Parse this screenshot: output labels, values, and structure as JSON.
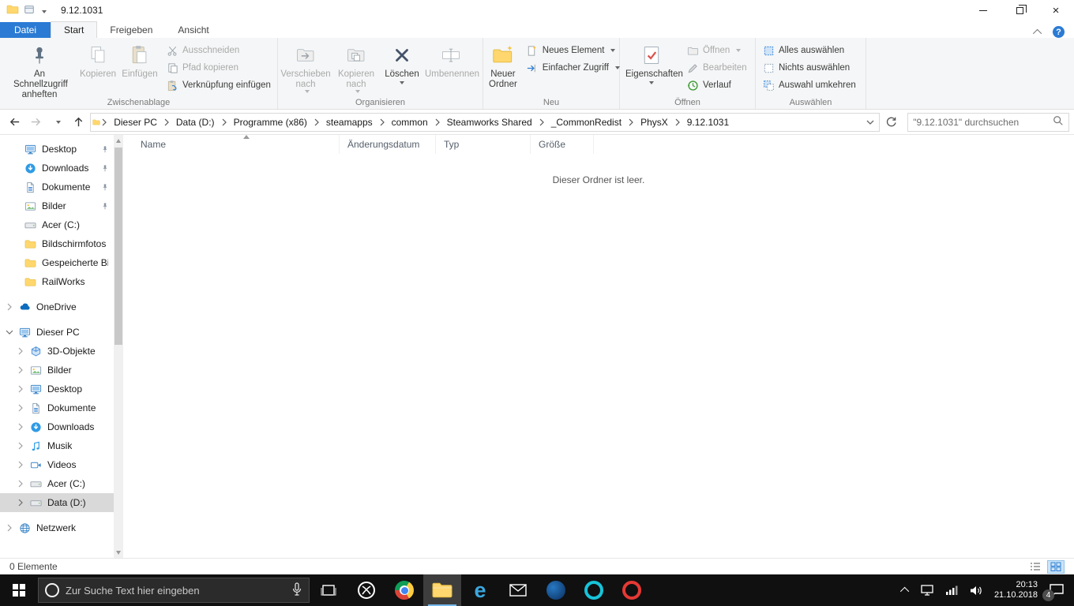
{
  "titlebar": {
    "title": "9.12.1031"
  },
  "tabs": {
    "file": "Datei",
    "start": "Start",
    "share": "Freigeben",
    "view": "Ansicht"
  },
  "ribbon": {
    "clipboard": {
      "pin": "An Schnellzugriff anheften",
      "copy": "Kopieren",
      "paste": "Einfügen",
      "cut": "Ausschneiden",
      "copy_path": "Pfad kopieren",
      "paste_shortcut": "Verknüpfung einfügen",
      "label": "Zwischenablage"
    },
    "organize": {
      "move_to": "Verschieben nach",
      "copy_to": "Kopieren nach",
      "delete": "Löschen",
      "rename": "Umbenennen",
      "label": "Organisieren"
    },
    "new": {
      "new_folder": "Neuer Ordner",
      "new_item": "Neues Element",
      "easy_access": "Einfacher Zugriff",
      "label": "Neu"
    },
    "open": {
      "properties": "Eigenschaften",
      "open": "Öffnen",
      "edit": "Bearbeiten",
      "history": "Verlauf",
      "label": "Öffnen"
    },
    "select": {
      "select_all": "Alles auswählen",
      "select_none": "Nichts auswählen",
      "invert": "Auswahl umkehren",
      "label": "Auswählen"
    }
  },
  "addressbar": {
    "crumbs": [
      "Dieser PC",
      "Data (D:)",
      "Programme (x86)",
      "steamapps",
      "common",
      "Steamworks Shared",
      "_CommonRedist",
      "PhysX",
      "9.12.1031"
    ],
    "search_placeholder": "\"9.12.1031\" durchsuchen"
  },
  "sidebar": {
    "qa_desktop": "Desktop",
    "qa_downloads": "Downloads",
    "qa_documents": "Dokumente",
    "qa_pictures": "Bilder",
    "qa_acer": "Acer (C:)",
    "qa_screenshots": "Bildschirmfotos",
    "qa_saved_pictures": "Gespeicherte Bilder",
    "qa_railworks": "RailWorks",
    "onedrive": "OneDrive",
    "this_pc": "Dieser PC",
    "pc_3d": "3D-Objekte",
    "pc_pictures": "Bilder",
    "pc_desktop": "Desktop",
    "pc_documents": "Dokumente",
    "pc_downloads": "Downloads",
    "pc_music": "Musik",
    "pc_videos": "Videos",
    "pc_acer": "Acer (C:)",
    "pc_data": "Data (D:)",
    "network": "Netzwerk"
  },
  "content": {
    "columns": {
      "name": "Name",
      "date": "Änderungsdatum",
      "type": "Typ",
      "size": "Größe"
    },
    "empty": "Dieser Ordner ist leer."
  },
  "statusbar": {
    "count": "0 Elemente"
  },
  "taskbar": {
    "search_placeholder": "Zur Suche Text hier eingeben",
    "time": "20:13",
    "date": "21.10.2018",
    "badge": "4"
  }
}
